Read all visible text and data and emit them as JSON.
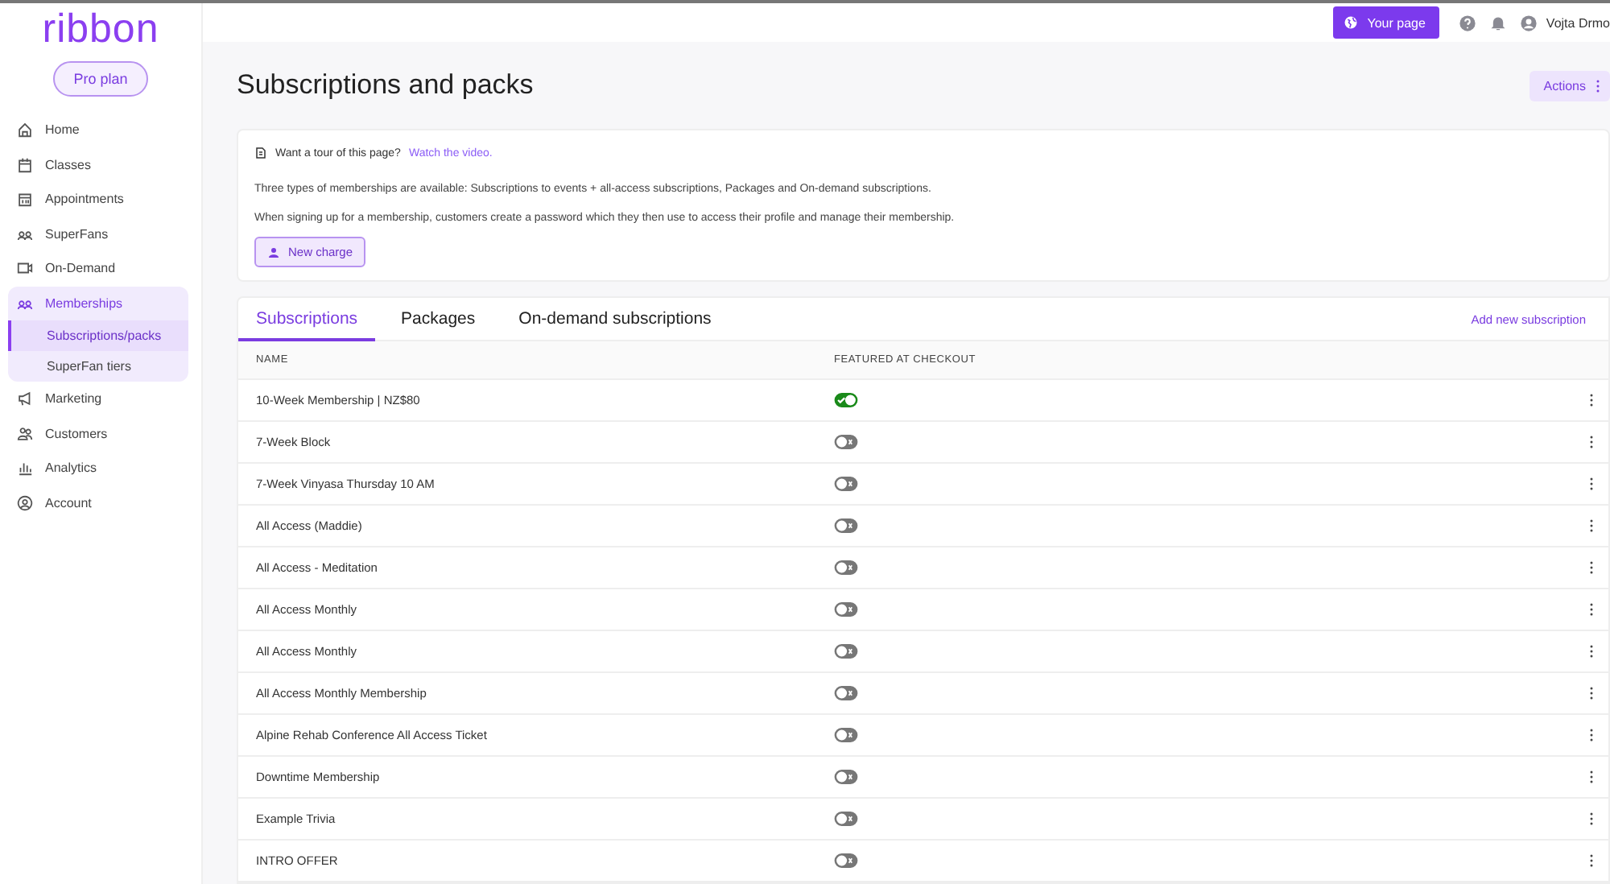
{
  "logo": "ribbon",
  "plan": "Pro plan",
  "sidebar": {
    "items": [
      {
        "label": "Home",
        "selected": false
      },
      {
        "label": "Classes",
        "selected": false
      },
      {
        "label": "Appointments",
        "selected": false
      },
      {
        "label": "SuperFans",
        "selected": false
      },
      {
        "label": "On-Demand",
        "selected": false
      },
      {
        "label": "Memberships",
        "selected": true,
        "expanded": true,
        "children": [
          {
            "label": "Subscriptions/packs",
            "selected": true
          },
          {
            "label": "SuperFan tiers",
            "selected": false
          }
        ]
      },
      {
        "label": "Marketing",
        "selected": false
      },
      {
        "label": "Customers",
        "selected": false
      },
      {
        "label": "Analytics",
        "selected": false
      },
      {
        "label": "Account",
        "selected": false
      }
    ]
  },
  "topbar": {
    "your_page": "Your page",
    "user": "Vojta Drmo"
  },
  "page": {
    "title": "Subscriptions and packs",
    "actions": "Actions"
  },
  "info": {
    "tour": "Want a tour of this page?",
    "tour_link": "Watch the video.",
    "paragraphs": [
      "Three types of memberships are available: Subscriptions to events + all-access subscriptions, Packages and On-demand subscriptions.",
      "When signing up for a membership, customers create a password which they then use to access their profile and manage their membership."
    ],
    "button": "New charge"
  },
  "tabs": [
    {
      "label": "Subscriptions",
      "selected": true
    },
    {
      "label": "Packages",
      "selected": false
    },
    {
      "label": "On-demand subscriptions",
      "selected": false
    }
  ],
  "add_link": "Add new subscription",
  "table": {
    "columns": [
      "NAME",
      "FEATURED AT CHECKOUT"
    ],
    "rows": [
      {
        "name": "10-Week Membership | NZ$80",
        "featured": true
      },
      {
        "name": "7-Week Block",
        "featured": false
      },
      {
        "name": "7-Week Vinyasa Thursday 10 AM",
        "featured": false
      },
      {
        "name": "All Access (Maddie)",
        "featured": false
      },
      {
        "name": "All Access - Meditation",
        "featured": false
      },
      {
        "name": "All Access Monthly",
        "featured": false
      },
      {
        "name": "All Access Monthly",
        "featured": false
      },
      {
        "name": "All Access Monthly Membership",
        "featured": false
      },
      {
        "name": "Alpine Rehab Conference All Access Ticket",
        "featured": false
      },
      {
        "name": "Downtime Membership",
        "featured": false
      },
      {
        "name": "Example Trivia",
        "featured": false
      },
      {
        "name": "INTRO OFFER",
        "featured": false
      }
    ]
  }
}
